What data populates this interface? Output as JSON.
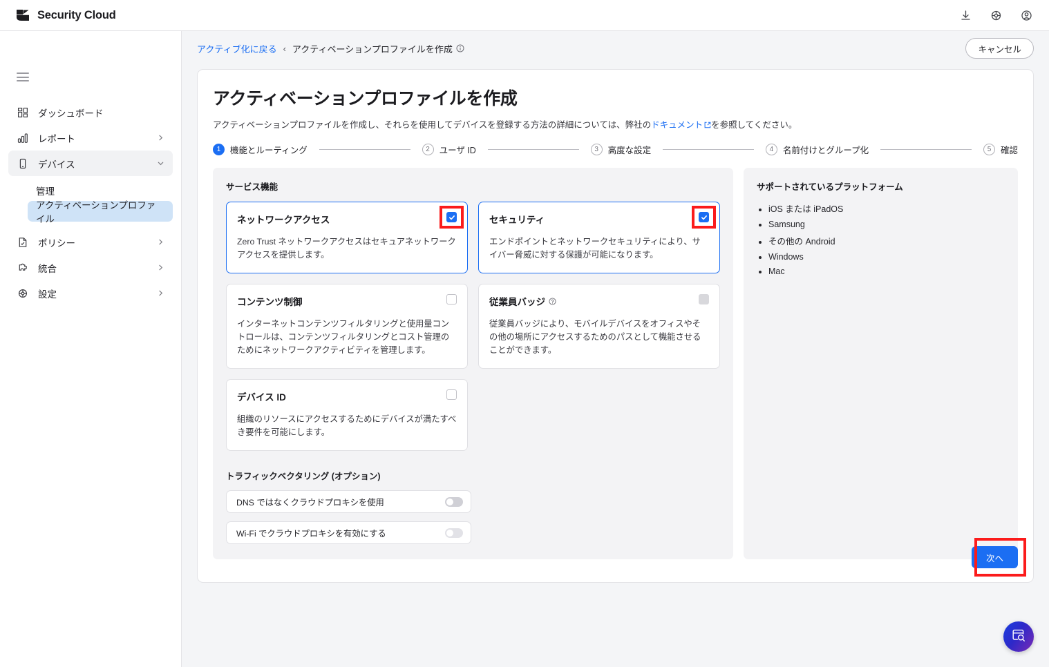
{
  "app": {
    "brand": "Security Cloud",
    "logo_icon": "security-cloud-logo",
    "header_icons": [
      "download-icon",
      "gear-icon",
      "account-icon"
    ]
  },
  "sidebar": {
    "menu_icon": "hamburger-menu-icon",
    "items": [
      {
        "label": "ダッシュボード",
        "icon": "dashboard-grid-icon",
        "chevron": "",
        "active": false
      },
      {
        "label": "レポート",
        "icon": "bar-chart-icon",
        "chevron": "›",
        "active": false
      },
      {
        "label": "デバイス",
        "icon": "mobile-device-icon",
        "chevron": "⌄",
        "active": true
      }
    ],
    "sub_items": [
      {
        "label": "管理",
        "selected": false
      },
      {
        "label": "アクティベーションプロファイル",
        "selected": true
      }
    ],
    "items_lower": [
      {
        "label": "ポリシー",
        "icon": "policy-document-icon",
        "chevron": "›"
      },
      {
        "label": "統合",
        "icon": "puzzle-piece-icon",
        "chevron": "›"
      },
      {
        "label": "設定",
        "icon": "settings-gear-icon",
        "chevron": "›"
      }
    ]
  },
  "breadcrumb": {
    "back_link": "アクティブ化に戻る",
    "separator": "‹",
    "current": "アクティベーションプロファイルを作成",
    "info_icon": "info-circle-icon"
  },
  "cancel_button": "キャンセル",
  "page": {
    "title": "アクティベーションプロファイルを作成",
    "desc_before": "アクティベーションプロファイルを作成し、それらを使用してデバイスを登録する方法の詳細については、弊社の",
    "desc_link": "ドキュメント",
    "desc_after": "を参照してください。",
    "external_link_icon": "external-link-icon"
  },
  "stepper": [
    {
      "num": "1",
      "label": "機能とルーティング",
      "state": "current"
    },
    {
      "num": "2",
      "label": "ユーザ ID",
      "state": "todo"
    },
    {
      "num": "3",
      "label": "高度な設定",
      "state": "todo"
    },
    {
      "num": "4",
      "label": "名前付けとグループ化",
      "state": "todo"
    },
    {
      "num": "5",
      "label": "確認",
      "state": "todo"
    }
  ],
  "service_features": {
    "heading": "サービス機能",
    "cards": [
      {
        "title": "ネットワークアクセス",
        "desc": "Zero Trust ネットワークアクセスはセキュアネットワークアクセスを提供します。",
        "checkbox": "checked",
        "highlighted": true
      },
      {
        "title": "セキュリティ",
        "desc": "エンドポイントとネットワークセキュリティにより、サイバー脅威に対する保護が可能になります。",
        "checkbox": "checked",
        "highlighted": true
      },
      {
        "title": "コンテンツ制御",
        "desc": "インターネットコンテンツフィルタリングと使用量コントロールは、コンテンツフィルタリングとコスト管理のためにネットワークアクティビティを管理します。",
        "checkbox": "unchecked",
        "highlighted": false
      },
      {
        "title": "従業員バッジ",
        "title_icon": "help-circle-icon",
        "desc": "従業員バッジにより、モバイルデバイスをオフィスやその他の場所にアクセスするためのパスとして機能させることができます。",
        "checkbox": "disabled",
        "highlighted": false
      },
      {
        "title": "デバイス ID",
        "desc": "組織のリソースにアクセスするためにデバイスが満たすべき要件を可能にします。",
        "checkbox": "unchecked",
        "highlighted": false
      }
    ]
  },
  "traffic_vectoring": {
    "heading": "トラフィックベクタリング (オプション)",
    "toggles": [
      {
        "label": "DNS ではなくクラウドプロキシを使用",
        "state": "off"
      },
      {
        "label": "Wi-Fi でクラウドプロキシを有効にする",
        "state": "off-disabled"
      }
    ]
  },
  "platforms": {
    "heading": "サポートされているプラットフォーム",
    "items": [
      "iOS または iPadOS",
      "Samsung",
      "その他の Android",
      "Windows",
      "Mac"
    ]
  },
  "next_button": "次へ",
  "annotation": {
    "arrow_icon": "red-arrow-right",
    "color": "#fb1b1b"
  },
  "fab": {
    "icon": "window-search-icon"
  },
  "colors": {
    "accent": "#1b6ef3",
    "highlight": "#fb1b1b",
    "selected_nav": "#cfe3f7",
    "panel_bg": "#f3f3f5"
  }
}
